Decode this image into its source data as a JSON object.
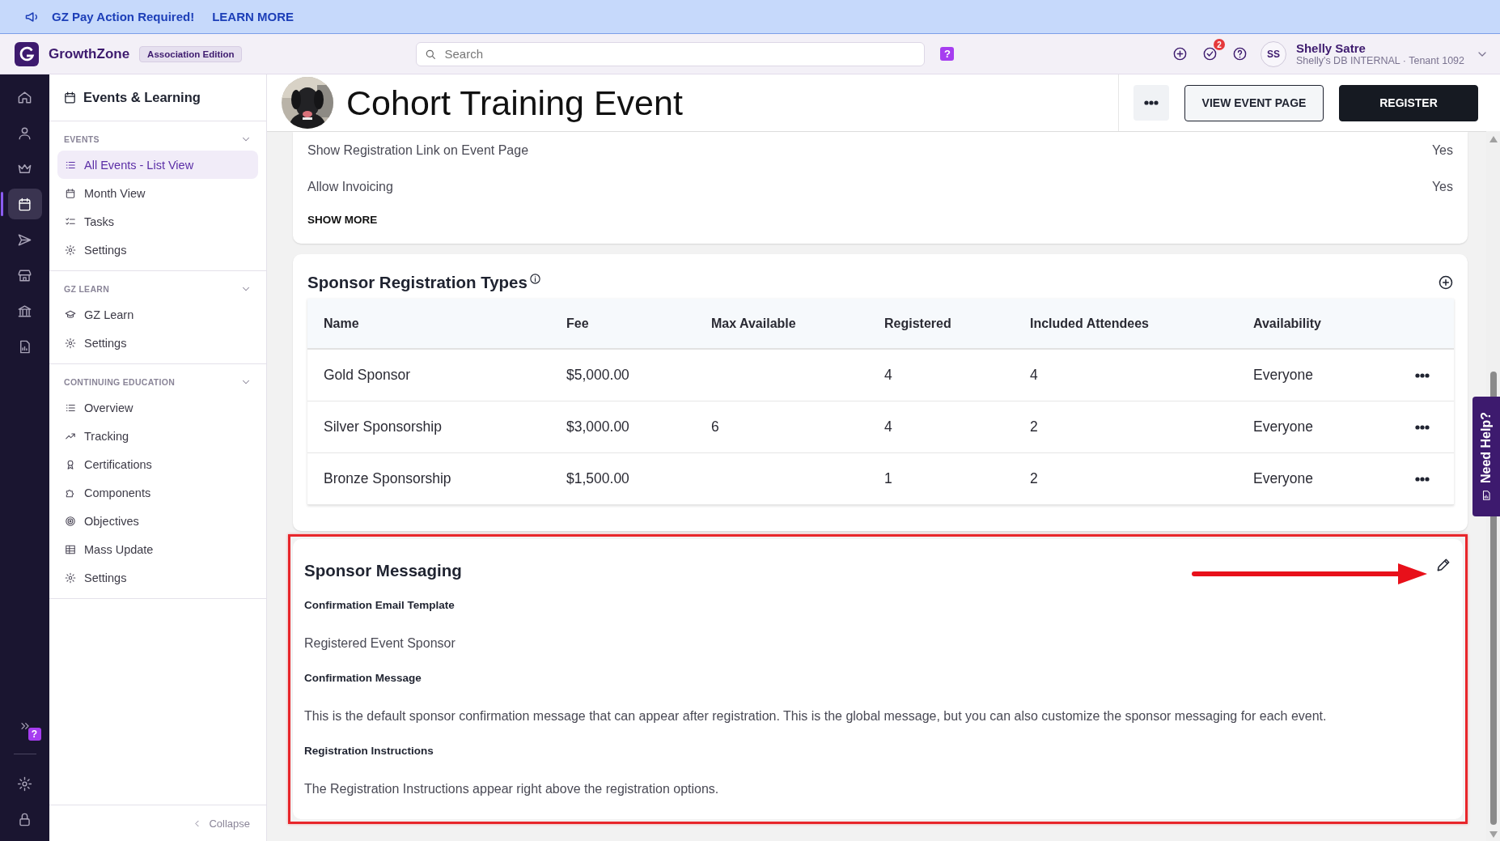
{
  "banner": {
    "message": "GZ Pay Action Required!",
    "link": "LEARN MORE"
  },
  "topbar": {
    "brand": "GrowthZone",
    "edition": "Association Edition",
    "search": {
      "placeholder": "Search"
    },
    "help_badge": "?",
    "notification_count": "2",
    "user": {
      "initials": "SS",
      "name": "Shelly Satre",
      "subtitle": "Shelly's DB INTERNAL · Tenant 1092"
    }
  },
  "rail": {
    "items": [
      {
        "selected": false
      },
      {
        "selected": false
      },
      {
        "selected": false
      },
      {
        "selected": true
      },
      {
        "selected": false
      },
      {
        "selected": false
      },
      {
        "selected": false
      },
      {
        "selected": false
      }
    ],
    "help_badge": "?"
  },
  "sidebar": {
    "title": "Events & Learning",
    "sections": [
      {
        "title": "EVENTS",
        "expanded": true,
        "items": [
          {
            "label": "All Events - List View",
            "selected": true
          },
          {
            "label": "Month View",
            "selected": false
          },
          {
            "label": "Tasks",
            "selected": false
          },
          {
            "label": "Settings",
            "selected": false
          }
        ]
      },
      {
        "title": "GZ LEARN",
        "expanded": true,
        "items": [
          {
            "label": "GZ Learn",
            "selected": false
          },
          {
            "label": "Settings",
            "selected": false
          }
        ]
      },
      {
        "title": "CONTINUING EDUCATION",
        "expanded": true,
        "items": [
          {
            "label": "Overview",
            "selected": false
          },
          {
            "label": "Tracking",
            "selected": false
          },
          {
            "label": "Certifications",
            "selected": false
          },
          {
            "label": "Components",
            "selected": false
          },
          {
            "label": "Objectives",
            "selected": false
          },
          {
            "label": "Mass Update",
            "selected": false
          },
          {
            "label": "Settings",
            "selected": false
          }
        ]
      }
    ],
    "collapse": "Collapse"
  },
  "event": {
    "title": "Cohort Training Event",
    "actions": [
      {
        "label": "VIEW EVENT PAGE",
        "kind": "outline"
      },
      {
        "label": "REGISTER",
        "kind": "primary"
      }
    ]
  },
  "settings": {
    "rows": [
      {
        "label": "Show Registration Link on Event Page",
        "value": "Yes"
      },
      {
        "label": "Allow Invoicing",
        "value": "Yes"
      }
    ],
    "show_more": "SHOW MORE"
  },
  "sponsor_types": {
    "title": "Sponsor Registration Types",
    "columns": [
      "Name",
      "Fee",
      "Max Available",
      "Registered",
      "Included Attendees",
      "Availability"
    ],
    "rows": [
      {
        "name": "Gold Sponsor",
        "fee": "$5,000.00",
        "registered": "4",
        "included_attendees": "4",
        "availability": "Everyone"
      },
      {
        "name": "Silver Sponsorship",
        "fee": "$3,000.00",
        "max_available": "6",
        "registered": "4",
        "included_attendees": "2",
        "availability": "Everyone"
      },
      {
        "name": "Bronze Sponsorship",
        "fee": "$1,500.00",
        "registered": "1",
        "included_attendees": "2",
        "availability": "Everyone"
      }
    ]
  },
  "sponsor_messaging": {
    "title": "Sponsor Messaging",
    "highlighted": true,
    "fields": [
      {
        "label": "Confirmation Email Template",
        "value": "Registered Event Sponsor"
      },
      {
        "label": "Confirmation Message",
        "value": "This is the default sponsor confirmation message that can appear after registration. This is the global message, but you can also customize the sponsor messaging for each event."
      },
      {
        "label": "Registration Instructions",
        "value": "The Registration Instructions appear right above the registration options."
      }
    ]
  },
  "need_help": "Need Help?"
}
